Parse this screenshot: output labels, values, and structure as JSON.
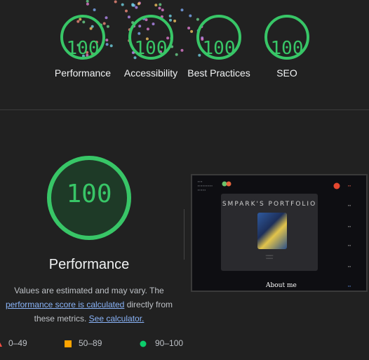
{
  "colors": {
    "pass": "#0cce6b",
    "pass_text": "#38c667",
    "average": "#ffa400",
    "fail": "#ff4e42",
    "link": "#8ab4f8"
  },
  "category_scores": [
    {
      "label": "Performance",
      "score": "100"
    },
    {
      "label": "Accessibility",
      "score": "100"
    },
    {
      "label": "Best Practices",
      "score": "100"
    },
    {
      "label": "SEO",
      "score": "100"
    }
  ],
  "main": {
    "score": "100",
    "title": "Performance",
    "desc_line1": "Values are estimated and may vary. The",
    "link1": "performance score is calculated",
    "desc_line2b": " directly from",
    "desc_line3": "these metrics. ",
    "link2": "See calculator."
  },
  "legend": [
    {
      "range": "0–49",
      "icon": "triangle-icon"
    },
    {
      "range": "50–89",
      "icon": "square-icon"
    },
    {
      "range": "90–100",
      "icon": "circle-icon"
    }
  ],
  "screenshot": {
    "card_title": "SMPARK'S PORTFOLIO",
    "heading": "About me"
  }
}
